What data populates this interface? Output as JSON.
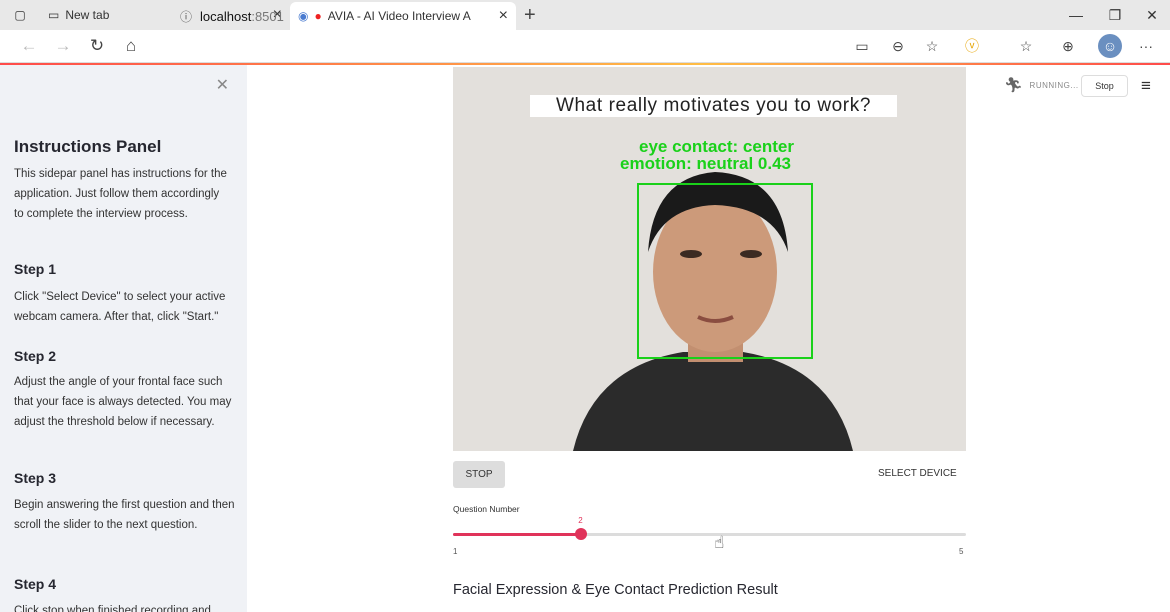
{
  "browser": {
    "tabs": [
      {
        "label": "New tab"
      },
      {
        "label": "AVIA - AI Video Interview A"
      }
    ],
    "address": {
      "host": "localhost",
      "port": ":8501"
    }
  },
  "sidebar": {
    "title": "Instructions Panel",
    "intro": "This sidepar panel has instructions for the application. Just follow them accordingly to complete the interview process.",
    "steps": [
      {
        "heading": "Step 1",
        "text": "Click \"Select Device\" to select your active webcam camera. After that, click \"Start.\""
      },
      {
        "heading": "Step 2",
        "text": "Adjust the angle of your frontal face such that your face is always detected. You may adjust the threshold below if necessary."
      },
      {
        "heading": "Step 3",
        "text": "Begin answering the first question and then scroll the slider to the next question."
      },
      {
        "heading": "Step 4",
        "text": "Click stop when finished recording and"
      }
    ]
  },
  "header": {
    "status": "RUNNING...",
    "stop_label": "Stop"
  },
  "video": {
    "question": "What really motivates you to work?",
    "eye_contact": "eye contact: center",
    "emotion": "emotion: neutral 0.43"
  },
  "controls": {
    "stop_label": "STOP",
    "select_device_label": "SELECT DEVICE",
    "slider": {
      "label": "Question Number",
      "min": 1,
      "max": 5,
      "value": 2
    }
  },
  "result": {
    "heading": "Facial Expression & Eye Contact Prediction Result"
  },
  "colors": {
    "accent": "#e0335a",
    "face_box": "#1ad11a",
    "sidebar_bg": "#f0f2f6"
  }
}
